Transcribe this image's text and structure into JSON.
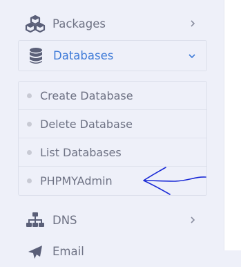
{
  "sidebar": {
    "items": [
      {
        "label": "Packages",
        "icon": "cubes-icon"
      },
      {
        "label": "Databases",
        "icon": "database-icon",
        "active": true,
        "accent": "#3f7bd8"
      },
      {
        "label": "DNS",
        "icon": "sitemap-icon"
      },
      {
        "label": "Email",
        "icon": "paper-plane-icon"
      }
    ],
    "databases_submenu": [
      {
        "label": "Create Database"
      },
      {
        "label": "Delete Database"
      },
      {
        "label": "List Databases"
      },
      {
        "label": "PHPMYAdmin"
      }
    ]
  },
  "colors": {
    "sidebar_bg": "#eef0f9",
    "text": "#6e7284",
    "accent": "#3f7bd8",
    "icon": "#5a5f78",
    "annotation": "#1a2ad6"
  }
}
